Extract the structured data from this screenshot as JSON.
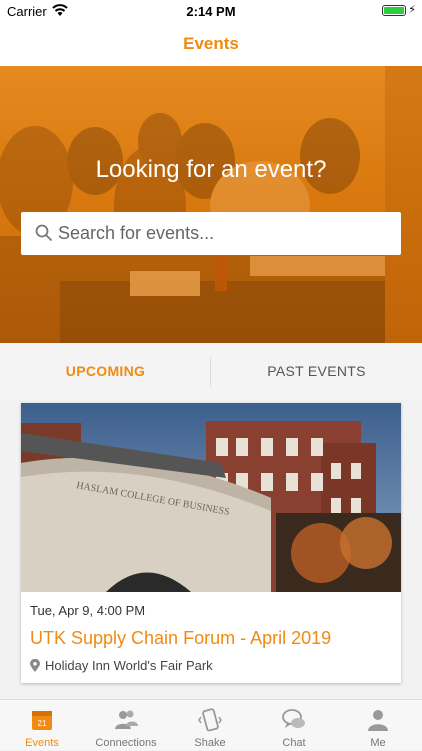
{
  "status_bar": {
    "carrier": "Carrier",
    "time": "2:14 PM",
    "battery_level": 1.0
  },
  "nav": {
    "title": "Events"
  },
  "hero": {
    "headline": "Looking for an event?"
  },
  "search": {
    "placeholder": "Search for events...",
    "value": ""
  },
  "tabs": [
    {
      "label": "UPCOMING",
      "active": true
    },
    {
      "label": "PAST EVENTS",
      "active": false
    }
  ],
  "events": [
    {
      "date": "Tue, Apr 9, 4:00 PM",
      "title": "UTK Supply Chain Forum - April 2019",
      "location": "Holiday Inn World's Fair Park",
      "image_caption": "HASLAM COLLEGE OF BUSINESS"
    }
  ],
  "tab_bar": {
    "items": [
      {
        "label": "Events",
        "icon": "calendar-icon",
        "badge": "21",
        "active": true
      },
      {
        "label": "Connections",
        "icon": "people-icon",
        "active": false
      },
      {
        "label": "Shake",
        "icon": "phone-shake-icon",
        "active": false
      },
      {
        "label": "Chat",
        "icon": "chat-bubbles-icon",
        "active": false
      },
      {
        "label": "Me",
        "icon": "person-icon",
        "active": false
      }
    ]
  },
  "colors": {
    "accent": "#f08a12",
    "hero": "#d9790f"
  }
}
